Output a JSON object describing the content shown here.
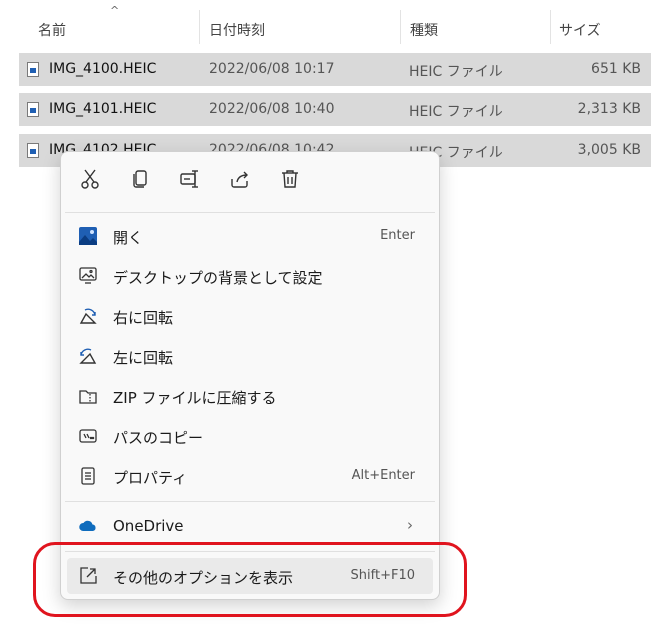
{
  "columns": {
    "name": "名前",
    "date": "日付時刻",
    "type": "種類",
    "size": "サイズ"
  },
  "files": [
    {
      "name": "IMG_4100.HEIC",
      "date": "2022/06/08 10:17",
      "type": "HEIC ファイル",
      "size": "651 KB"
    },
    {
      "name": "IMG_4101.HEIC",
      "date": "2022/06/08 10:40",
      "type": "HEIC ファイル",
      "size": "2,313 KB"
    },
    {
      "name": "IMG_4102.HEIC",
      "date": "2022/06/08 10:42",
      "type": "HEIC ファイル",
      "size": "3,005 KB"
    }
  ],
  "quick_actions": [
    {
      "icon": "cut-icon"
    },
    {
      "icon": "copy-icon"
    },
    {
      "icon": "rename-icon"
    },
    {
      "icon": "share-icon"
    },
    {
      "icon": "delete-icon"
    }
  ],
  "menu_items": {
    "open": {
      "label": "開く",
      "shortcut": "Enter",
      "icon": "image-icon"
    },
    "set_background": {
      "label": "デスクトップの背景として設定",
      "icon": "desktop-background-icon"
    },
    "rotate_right": {
      "label": "右に回転",
      "icon": "rotate-right-icon"
    },
    "rotate_left": {
      "label": "左に回転",
      "icon": "rotate-left-icon"
    },
    "zip": {
      "label": "ZIP ファイルに圧縮する",
      "icon": "zip-icon"
    },
    "copy_path": {
      "label": "パスのコピー",
      "icon": "copy-path-icon"
    },
    "properties": {
      "label": "プロパティ",
      "shortcut": "Alt+Enter",
      "icon": "properties-icon"
    },
    "onedrive": {
      "label": "OneDrive",
      "icon": "onedrive-icon"
    },
    "more_options": {
      "label": "その他のオプションを表示",
      "shortcut": "Shift+F10",
      "icon": "more-options-icon"
    }
  },
  "colors": {
    "highlight_box": "#e0141e",
    "selection": "#d9d9d9",
    "onedrive": "#0f6cbd"
  }
}
